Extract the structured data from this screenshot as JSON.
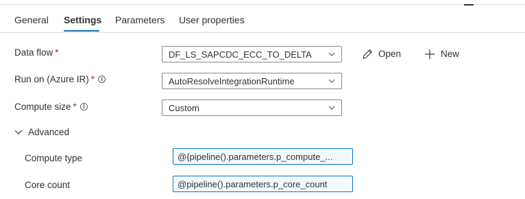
{
  "tabs": [
    {
      "label": "General"
    },
    {
      "label": "Settings"
    },
    {
      "label": "Parameters"
    },
    {
      "label": "User properties"
    }
  ],
  "active_tab": "Settings",
  "form": {
    "data_flow": {
      "label": "Data flow",
      "required_mark": "*",
      "value": "DF_LS_SAPCDC_ECC_TO_DELTA"
    },
    "run_on": {
      "label": "Run on (Azure IR)",
      "required_mark": "*",
      "info_glyph": "i",
      "value": "AutoResolveIntegrationRuntime"
    },
    "compute_size": {
      "label": "Compute size",
      "required_mark": "*",
      "info_glyph": "i",
      "value": "Custom"
    }
  },
  "actions": {
    "open_label": "Open",
    "new_label": "New"
  },
  "advanced": {
    "label": "Advanced",
    "expanded": true,
    "compute_type": {
      "label": "Compute type",
      "value": "@{pipeline().parameters.p_compute_..."
    },
    "core_count": {
      "label": "Core count",
      "value": "@pipeline().parameters.p_core_count"
    }
  },
  "colors": {
    "accent": "#0f6cbd",
    "required": "#a4262c",
    "expression_border": "#0078d4",
    "expression_bg": "#f3f9fd"
  },
  "icons": [
    "pencil-icon",
    "plus-icon",
    "chevron-down-icon",
    "info-icon"
  ]
}
